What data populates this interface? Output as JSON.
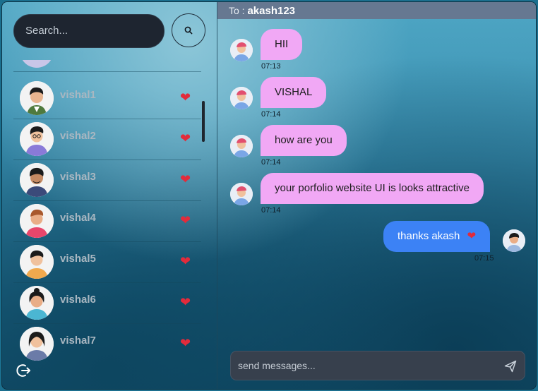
{
  "search": {
    "placeholder": "Search..."
  },
  "contacts": [
    {
      "name": "vishal1",
      "heart": "❤"
    },
    {
      "name": "vishal2",
      "heart": "❤"
    },
    {
      "name": "vishal3",
      "heart": "❤"
    },
    {
      "name": "vishal4",
      "heart": "❤"
    },
    {
      "name": "vishal5",
      "heart": "❤"
    },
    {
      "name": "vishal6",
      "heart": "❤"
    },
    {
      "name": "vishal7",
      "heart": "❤"
    }
  ],
  "chat": {
    "to_label": "To :",
    "to_name": "akash123",
    "messages": [
      {
        "text": "HII",
        "time": "07:13",
        "direction": "in"
      },
      {
        "text": "VISHAL",
        "time": "07:14",
        "direction": "in"
      },
      {
        "text": "how are you",
        "time": "07:14",
        "direction": "in"
      },
      {
        "text": "your porfolio website UI is looks attractive",
        "time": "07:14",
        "direction": "in"
      },
      {
        "text": "thanks akash",
        "emoji": "❤",
        "time": "07:15",
        "direction": "out"
      }
    ],
    "composer_placeholder": "send messages..."
  },
  "colors": {
    "incoming_bubble": "#f1a8f5",
    "outgoing_bubble": "#3c82f5",
    "header_bar": "#667891",
    "heart": "#e22b3b"
  },
  "icons": {
    "search": "search-icon",
    "logout": "logout-icon",
    "send": "send-icon",
    "heart": "heart-icon"
  }
}
